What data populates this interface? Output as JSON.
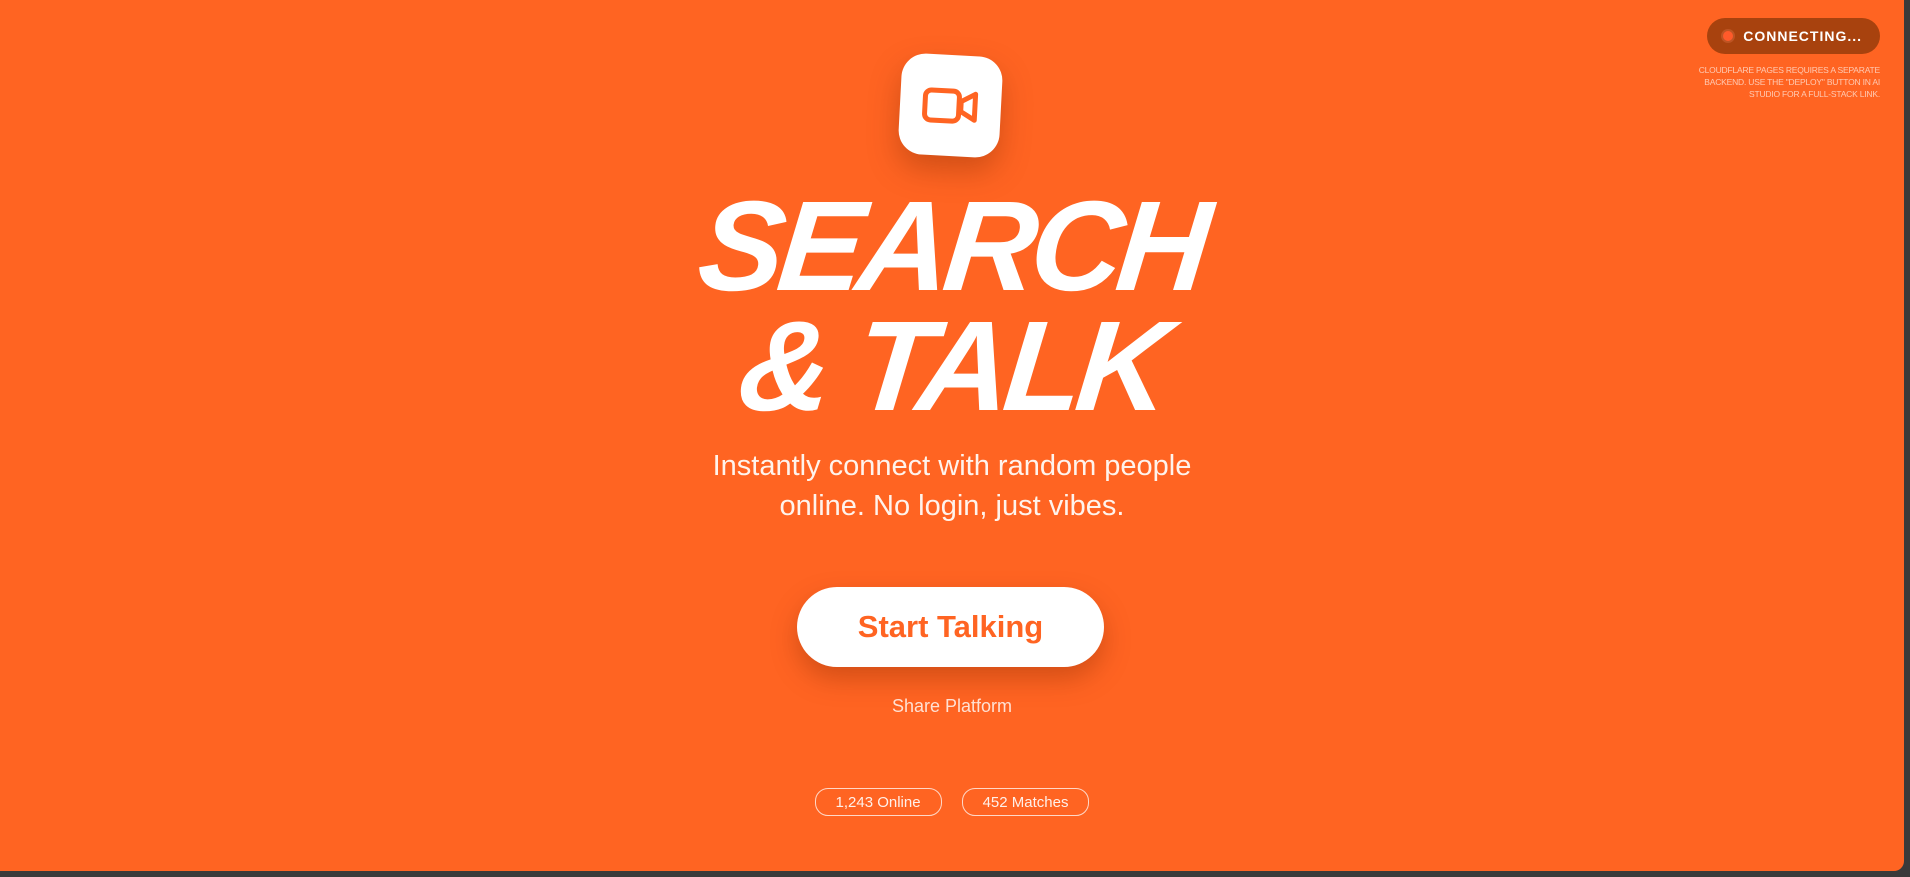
{
  "status": {
    "label": "CONNECTING...",
    "note": "CLOUDFLARE PAGES REQUIRES A SEPARATE BACKEND. USE THE \"DEPLOY\" BUTTON IN AI STUDIO FOR A FULL-STACK LINK.",
    "dot_color": "#ff5a2a"
  },
  "hero": {
    "logo_icon": "video-camera-icon",
    "title_line_1": "SEARCH",
    "title_line_2": "& TALK",
    "subtitle_line_1": "Instantly connect with random people",
    "subtitle_line_2": "online. No login, just vibes.",
    "cta_label": "Start Talking",
    "share_label": "Share Platform"
  },
  "stats": {
    "online": "1,243 Online",
    "matches": "452 Matches"
  },
  "colors": {
    "background": "#ff6422",
    "accent": "#ff6422",
    "status_pill": "#a8420e",
    "text": "#ffffff"
  }
}
